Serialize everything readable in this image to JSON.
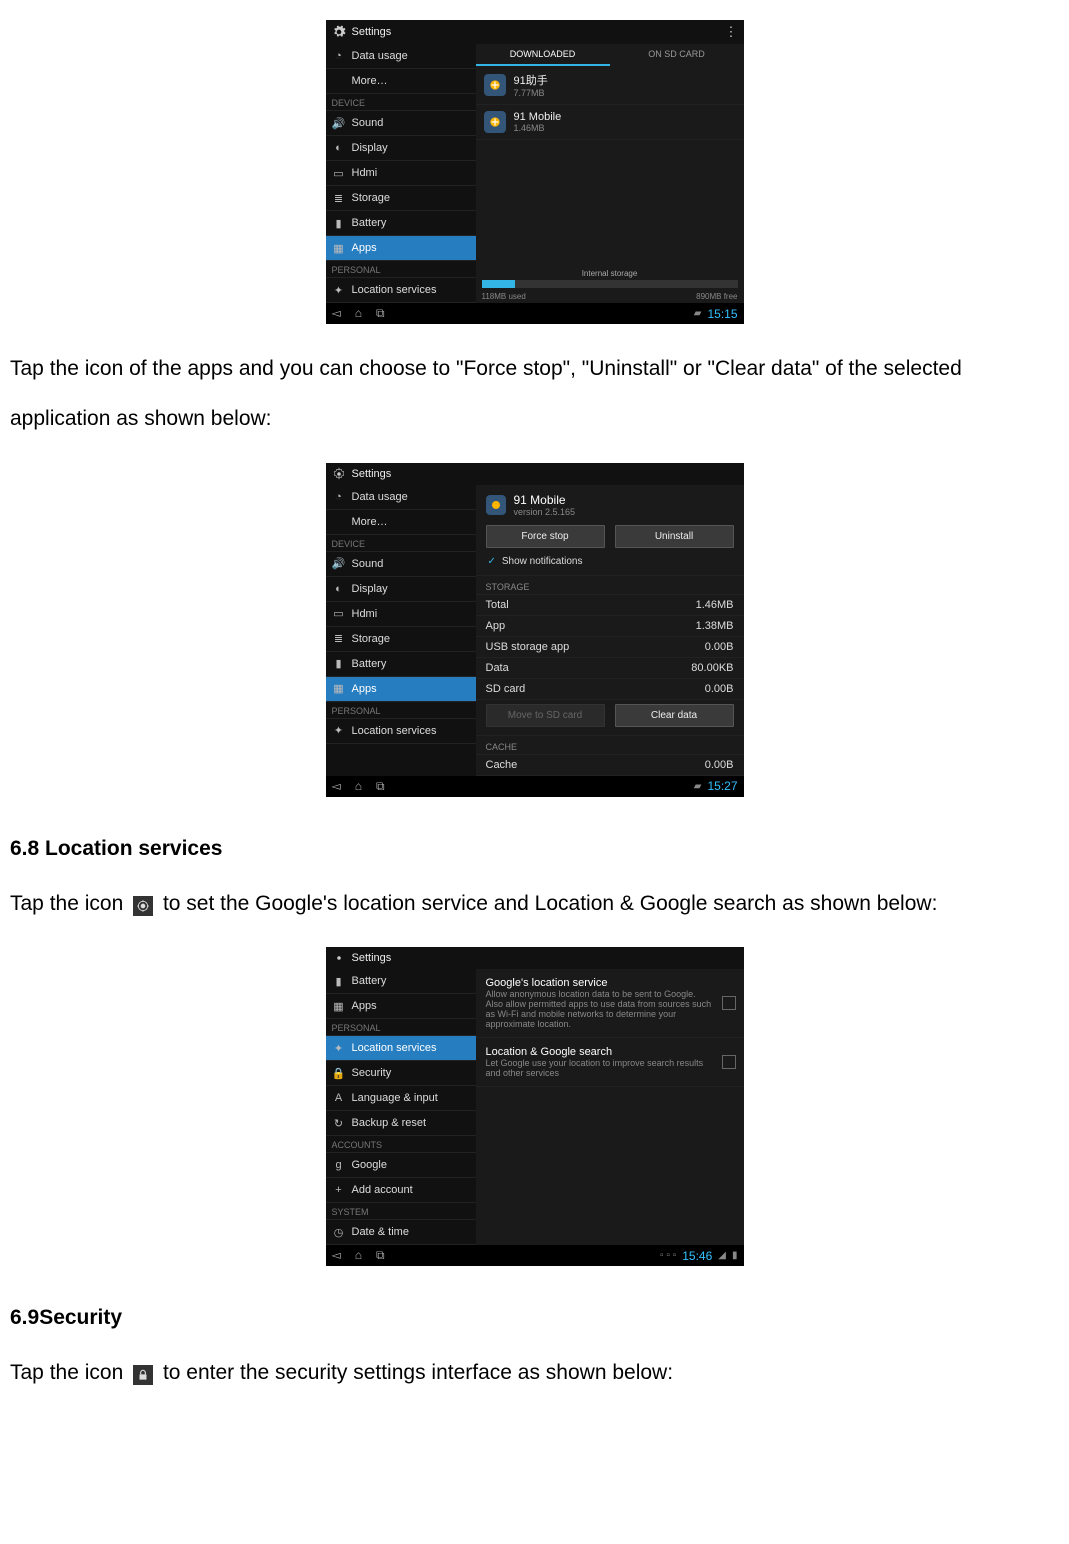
{
  "para1": "Tap the icon of the apps and you can choose to \"Force stop\", \"Uninstall\" or \"Clear data\" of the selected application as shown below:",
  "h68": "6.8 Location services",
  "para2a": "Tap the icon ",
  "para2b": " to set the Google's location service and Location & Google search as shown below:",
  "h69": "6.9Security",
  "para3a": "Tap the icon ",
  "para3b": " to enter the security settings interface as shown below:",
  "shot1": {
    "title": "Settings",
    "tabs": {
      "downloaded": "DOWNLOADED",
      "sd": "ON SD CARD"
    },
    "side_data": "Data usage",
    "side_more": "More…",
    "side_device": "DEVICE",
    "side_sound": "Sound",
    "side_display": "Display",
    "side_hdmi": "Hdmi",
    "side_storage": "Storage",
    "side_battery": "Battery",
    "side_apps": "Apps",
    "side_personal": "PERSONAL",
    "side_loc": "Location services",
    "apps": {
      "a0_name": "91助手",
      "a0_sub": "7.77MB",
      "a1_name": "91 Mobile",
      "a1_sub": "1.46MB"
    },
    "storage": {
      "used": "118MB used",
      "label": "Internal storage",
      "free": "890MB free",
      "pct": 13
    },
    "time": "15:15"
  },
  "shot2": {
    "title": "Settings",
    "side_data": "Data usage",
    "side_more": "More…",
    "side_device": "DEVICE",
    "side_sound": "Sound",
    "side_display": "Display",
    "side_hdmi": "Hdmi",
    "side_storage": "Storage",
    "side_battery": "Battery",
    "side_apps": "Apps",
    "side_personal": "PERSONAL",
    "side_loc": "Location services",
    "app": {
      "name": "91 Mobile",
      "ver": "version 2.5.165"
    },
    "btn_force": "Force stop",
    "btn_uninstall": "Uninstall",
    "show_notif": "Show notifications",
    "sect_storage": "STORAGE",
    "kv_total_k": "Total",
    "kv_total_v": "1.46MB",
    "kv_app_k": "App",
    "kv_app_v": "1.38MB",
    "kv_usb_k": "USB storage app",
    "kv_usb_v": "0.00B",
    "kv_data_k": "Data",
    "kv_data_v": "80.00KB",
    "kv_sd_k": "SD card",
    "kv_sd_v": "0.00B",
    "btn_move": "Move to SD card",
    "btn_clear": "Clear data",
    "sect_cache": "CACHE",
    "kv_cache_k": "Cache",
    "kv_cache_v": "0.00B",
    "time": "15:27"
  },
  "shot3": {
    "title": "Settings",
    "side_battery": "Battery",
    "side_apps": "Apps",
    "side_personal": "PERSONAL",
    "side_loc": "Location services",
    "side_security": "Security",
    "side_lang": "Language & input",
    "side_backup": "Backup & reset",
    "side_accounts": "ACCOUNTS",
    "side_google": "Google",
    "side_add": "Add account",
    "side_system": "SYSTEM",
    "side_date": "Date & time",
    "loc1_t": "Google's location service",
    "loc1_s": "Allow anonymous location data to be sent to Google. Also allow permitted apps to use data from sources such as Wi-Fi and mobile networks to determine your approximate location.",
    "loc2_t": "Location & Google search",
    "loc2_s": "Let Google use your location to improve search results and other services",
    "time": "15:46"
  }
}
